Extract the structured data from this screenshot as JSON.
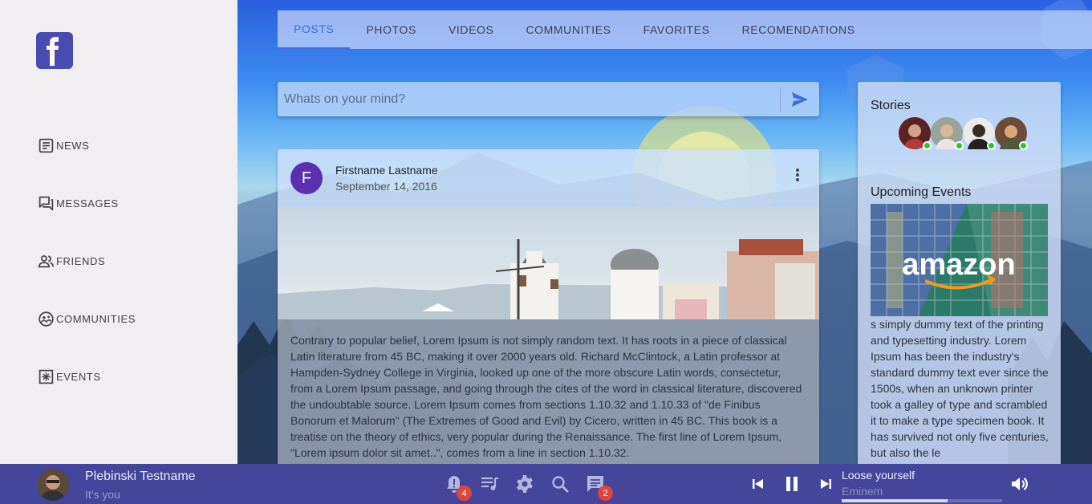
{
  "sidebar": {
    "logo": "facebook-icon",
    "items": [
      {
        "label": "NEWS",
        "icon": "newspaper-icon"
      },
      {
        "label": "MESSAGES",
        "icon": "forum-icon"
      },
      {
        "label": "FRIENDS",
        "icon": "people-icon"
      },
      {
        "label": "COMMUNITIES",
        "icon": "community-icon"
      },
      {
        "label": "EVENTS",
        "icon": "events-icon"
      }
    ]
  },
  "tabs": [
    {
      "label": "POSTS",
      "active": true
    },
    {
      "label": "PHOTOS",
      "active": false
    },
    {
      "label": "VIDEOS",
      "active": false
    },
    {
      "label": "COMMUNITIES",
      "active": false
    },
    {
      "label": "FAVORITES",
      "active": false
    },
    {
      "label": "RECOMENDATIONS",
      "active": false
    }
  ],
  "compose": {
    "placeholder": "Whats on your mind?"
  },
  "post": {
    "avatar_letter": "F",
    "author": "Firstname Lastname",
    "date": "September 14, 2016",
    "body": "Contrary to popular belief, Lorem Ipsum is not simply random text. It has roots in a piece of classical Latin literature from 45 BC, making it over 2000 years old. Richard McClintock, a Latin professor at Hampden-Sydney College in Virginia, looked up one of the more obscure Latin words, consectetur, from a Lorem Ipsum passage, and going through the cites of the word in classical literature, discovered the undoubtable source. Lorem Ipsum comes from sections 1.10.32 and 1.10.33 of \"de Finibus Bonorum et Malorum\" (The Extremes of Good and Evil) by Cicero, written in 45 BC. This book is a treatise on the theory of ethics, very popular during the Renaissance. The first line of Lorem Ipsum, \"Lorem ipsum dolor sit amet..\", comes from a line in section 1.10.32."
  },
  "stories": {
    "title": "Stories",
    "count": 4
  },
  "events": {
    "title": "Upcoming Events",
    "image_text": "amazon",
    "text": "s simply dummy text of the printing and typesetting industry. Lorem Ipsum has been the industry's standard dummy text ever since the 1500s, when an unknown printer took a galley of type and scrambled it to make a type specimen book. It has survived not only five centuries, but also the le"
  },
  "bottombar": {
    "user_name": "Plebinski Testname",
    "user_sub": "It's you",
    "notifications_count": "4",
    "messages_count": "2",
    "song_title": "Loose yourself",
    "song_artist": "Eminem",
    "progress": 0.66
  },
  "colors": {
    "accent": "#3f6fd6",
    "bottombar": "#43469b",
    "badge": "#e0453d",
    "online": "#31c231"
  }
}
